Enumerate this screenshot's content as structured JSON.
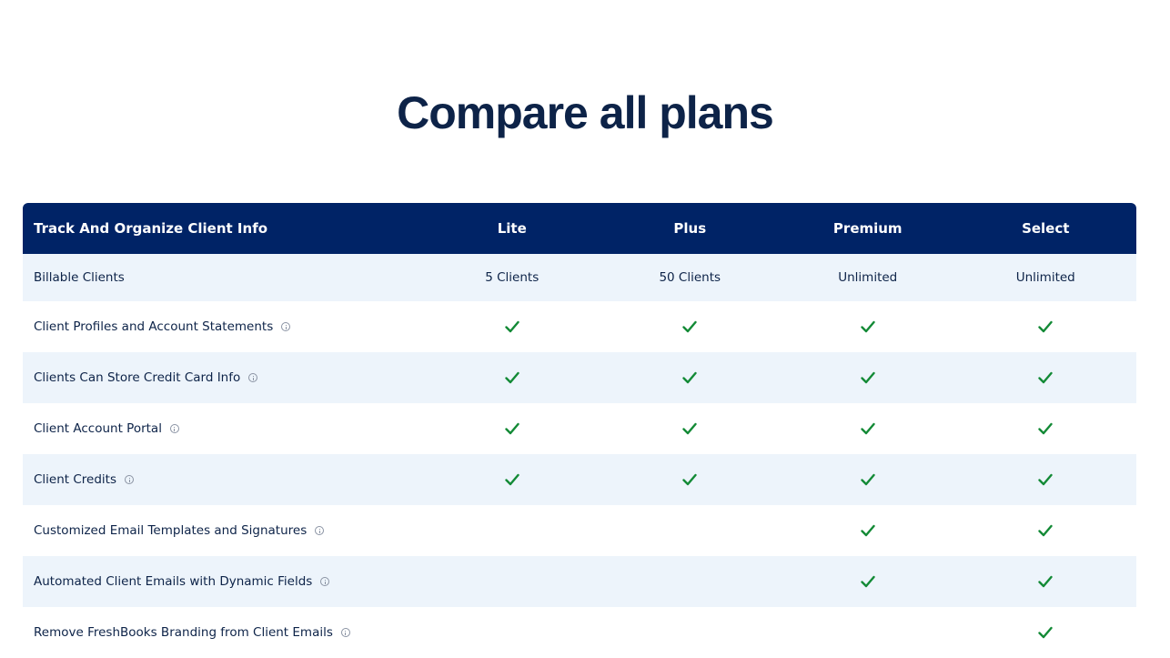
{
  "page": {
    "title": "Compare all plans"
  },
  "table": {
    "section_title": "Track And Organize Client Info",
    "plans": [
      "Lite",
      "Plus",
      "Premium",
      "Select"
    ],
    "rows": [
      {
        "label": "Billable Clients",
        "info": false,
        "values": [
          "5 Clients",
          "50 Clients",
          "Unlimited",
          "Unlimited"
        ]
      },
      {
        "label": "Client Profiles and Account Statements",
        "info": true,
        "values": [
          true,
          true,
          true,
          true
        ]
      },
      {
        "label": "Clients Can Store Credit Card Info",
        "info": true,
        "values": [
          true,
          true,
          true,
          true
        ]
      },
      {
        "label": "Client Account Portal",
        "info": true,
        "values": [
          true,
          true,
          true,
          true
        ]
      },
      {
        "label": "Client Credits",
        "info": true,
        "values": [
          true,
          true,
          true,
          true
        ]
      },
      {
        "label": "Customized Email Templates and Signatures",
        "info": true,
        "values": [
          false,
          false,
          true,
          true
        ]
      },
      {
        "label": "Automated Client Emails with Dynamic Fields",
        "info": true,
        "values": [
          false,
          false,
          true,
          true
        ]
      },
      {
        "label": "Remove FreshBooks Branding from Client Emails",
        "info": true,
        "values": [
          false,
          false,
          false,
          true
        ]
      }
    ]
  },
  "icons": {
    "check": "check-icon",
    "info": "info-icon"
  },
  "colors": {
    "header_bg": "#002366",
    "title_text": "#0d2348",
    "shaded_row": "#edf4fb",
    "check": "#138a36"
  }
}
